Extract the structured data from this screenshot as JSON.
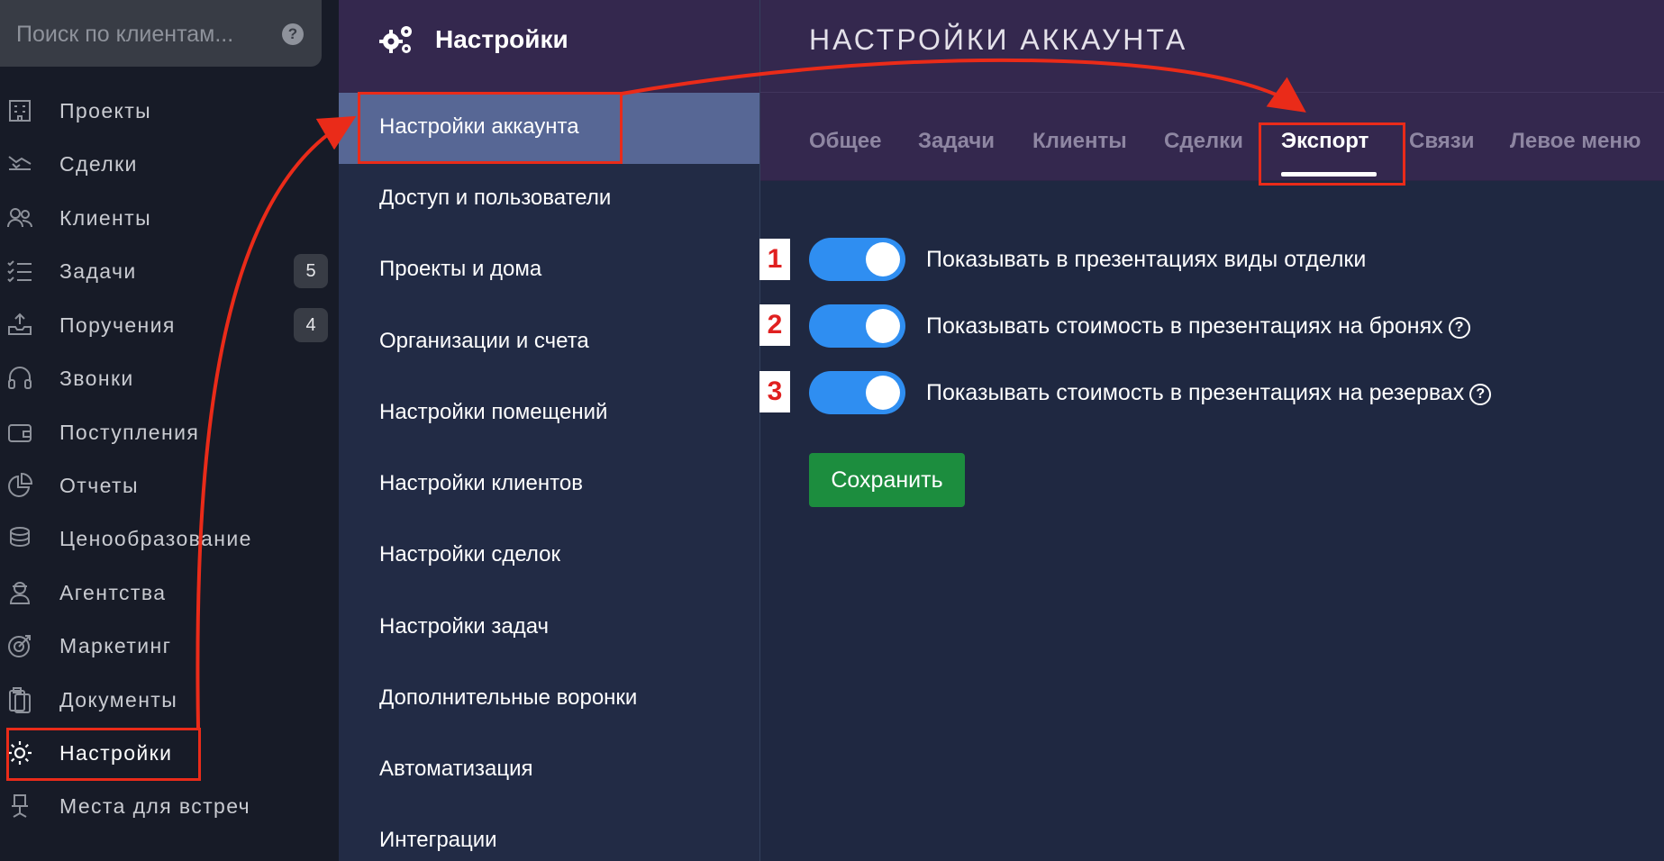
{
  "search": {
    "placeholder": "Поиск по клиентам...",
    "help": "?"
  },
  "nav": [
    {
      "label": "Проекты",
      "icon": "building-icon"
    },
    {
      "label": "Сделки",
      "icon": "handshake-icon"
    },
    {
      "label": "Клиенты",
      "icon": "users-icon"
    },
    {
      "label": "Задачи",
      "icon": "list-check-icon",
      "badge": "5"
    },
    {
      "label": "Поручения",
      "icon": "tray-upload-icon",
      "badge": "4"
    },
    {
      "label": "Звонки",
      "icon": "headset-icon"
    },
    {
      "label": "Поступления",
      "icon": "wallet-icon"
    },
    {
      "label": "Отчеты",
      "icon": "pie-chart-icon"
    },
    {
      "label": "Ценообразование",
      "icon": "coins-icon"
    },
    {
      "label": "Агентства",
      "icon": "agent-icon"
    },
    {
      "label": "Маркетинг",
      "icon": "target-icon"
    },
    {
      "label": "Документы",
      "icon": "clipboard-icon"
    },
    {
      "label": "Настройки",
      "icon": "gear-icon"
    },
    {
      "label": "Места для встреч",
      "icon": "chair-icon"
    }
  ],
  "settings_menu": {
    "title": "Настройки",
    "items": [
      "Настройки аккаунта",
      "Доступ и пользователи",
      "Проекты и дома",
      "Организации и счета",
      "Настройки помещений",
      "Настройки клиентов",
      "Настройки сделок",
      "Настройки задач",
      "Дополнительные воронки",
      "Автоматизация",
      "Интеграции"
    ]
  },
  "main": {
    "title": "НАСТРОЙКИ АККАУНТА",
    "tabs": [
      "Общее",
      "Задачи",
      "Клиенты",
      "Сделки",
      "Экспорт",
      "Связи",
      "Левое меню"
    ],
    "active_tab": "Экспорт",
    "settings": [
      {
        "label": "Показывать в презентациях виды отделки",
        "enabled": true,
        "help": false
      },
      {
        "label": "Показывать стоимость в презентациях на бронях",
        "enabled": true,
        "help": true
      },
      {
        "label": "Показывать стоимость в презентациях на резервах",
        "enabled": true,
        "help": true
      }
    ],
    "save_label": "Сохранить"
  },
  "annotations": {
    "numbers": [
      "1",
      "2",
      "3"
    ],
    "color": "#ea2b19"
  },
  "colors": {
    "toggle_on": "#2f8ef1",
    "save": "#1c8d3e",
    "header": "#34284e",
    "active_menu": "#576795"
  }
}
